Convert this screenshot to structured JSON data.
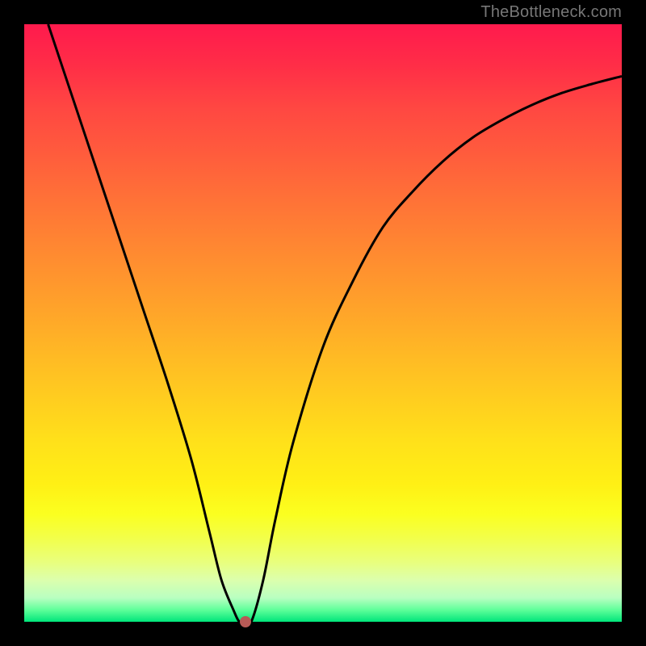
{
  "watermark": "TheBottleneck.com",
  "chart_data": {
    "type": "line",
    "title": "",
    "xlabel": "",
    "ylabel": "",
    "xlim": [
      0,
      100
    ],
    "ylim": [
      0,
      100
    ],
    "series": [
      {
        "name": "curve",
        "x": [
          4,
          8,
          12,
          16,
          20,
          24,
          28,
          31,
          33,
          35,
          36,
          37,
          38,
          40,
          42,
          45,
          50,
          55,
          60,
          65,
          70,
          75,
          80,
          85,
          90,
          95,
          100
        ],
        "y": [
          100,
          88,
          76,
          64,
          52,
          40,
          27,
          15,
          7,
          2,
          0,
          0,
          0,
          7,
          17,
          30,
          46,
          57,
          66,
          72,
          77,
          81,
          84,
          86.5,
          88.5,
          90,
          91.3
        ]
      }
    ],
    "marker": {
      "x": 37,
      "y": 0
    },
    "background_gradient": {
      "top": "#ff1a4d",
      "mid": "#ffd51f",
      "bottom": "#00e57a"
    },
    "frame_color": "#000000",
    "curve_color": "#000000",
    "marker_color": "#b75a56"
  }
}
